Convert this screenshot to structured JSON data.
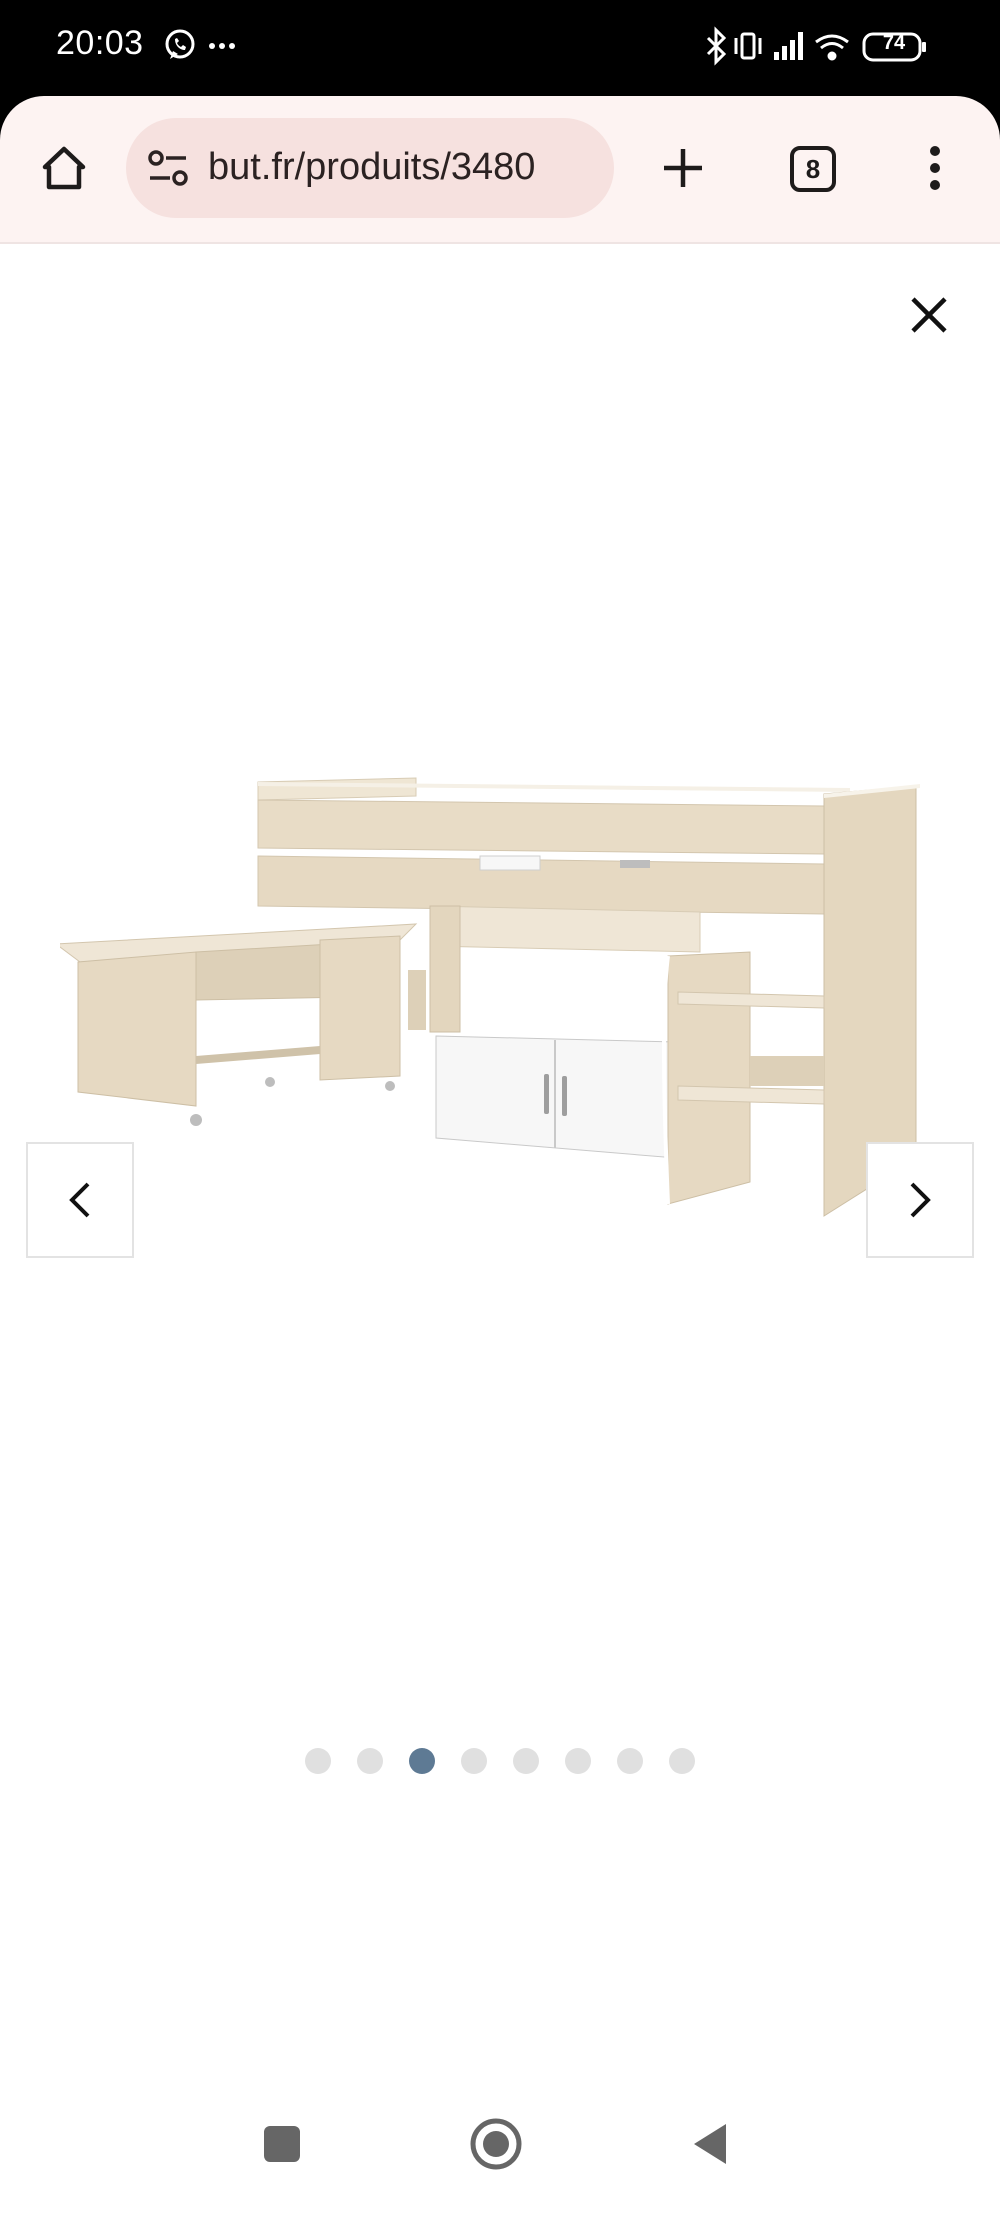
{
  "status_bar": {
    "time": "20:03",
    "battery": "74",
    "icons": [
      "whatsapp-icon",
      "more-dots-icon",
      "bluetooth-icon",
      "vibrate-icon",
      "signal-icon",
      "wifi-icon",
      "battery-icon"
    ]
  },
  "browser": {
    "url": "but.fr/produits/3480",
    "tab_count": "8",
    "icons": [
      "home-icon",
      "site-settings-icon",
      "plus-icon",
      "tabs-icon",
      "more-vert-icon"
    ]
  },
  "gallery": {
    "total_images": 8,
    "active_index": 2,
    "image_subject": "lit combiné bureau",
    "colors": {
      "active_dot": "#5e7a94",
      "inactive_dot": "#e0e0e0",
      "wood": "#e8dcc6",
      "white_panel": "#f7f7f7"
    }
  },
  "navigation_bar": {
    "buttons": [
      "recents-button",
      "home-button",
      "back-button"
    ]
  }
}
